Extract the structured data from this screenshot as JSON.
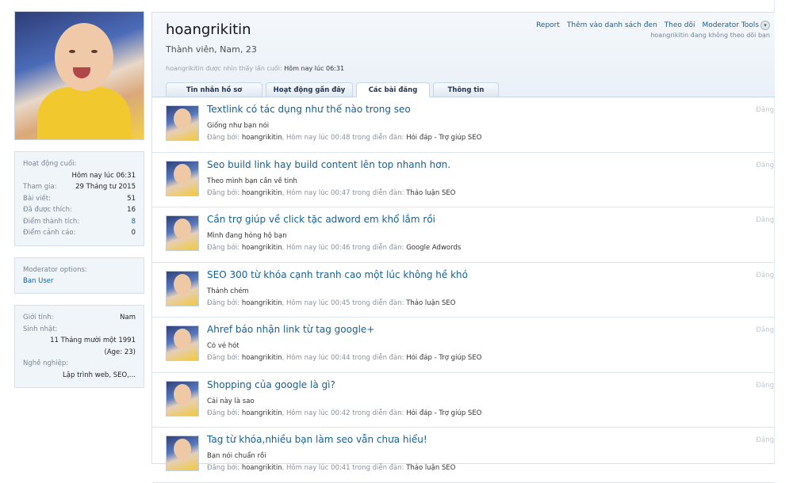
{
  "profile": {
    "username": "hoangrikitin",
    "user_title": "Thành viên, Nam, 23",
    "last_seen_label": "hoangrikitin được nhìn thấy lần cuối:",
    "last_seen_value": "Hôm nay lúc 06:31",
    "links": [
      "Report",
      "Thêm vào danh sách đen",
      "Theo dõi",
      "Moderator Tools"
    ],
    "not_following": "hoangrikitin đang không theo dõi bạn"
  },
  "tabs": [
    {
      "label": "Tin nhắn hồ sơ"
    },
    {
      "label": "Hoạt động gần đây"
    },
    {
      "label": "Các bài đăng",
      "active": true
    },
    {
      "label": "Thông tin"
    }
  ],
  "stats": {
    "last_activity_label": "Hoạt động cuối:",
    "last_activity_value": "Hôm nay lúc 06:31",
    "rows": [
      {
        "label": "Tham gia:",
        "value": "29 Tháng tư 2015"
      },
      {
        "label": "Bài viết:",
        "value": "51"
      },
      {
        "label": "Đã được thích:",
        "value": "16"
      },
      {
        "label": "Điểm thành tích:",
        "value": "8"
      },
      {
        "label": "Điểm cảnh cáo:",
        "value": "0"
      }
    ]
  },
  "moderator": {
    "label": "Moderator options:",
    "ban_user": "Ban User"
  },
  "info": {
    "gender_label": "Giới tính:",
    "gender_value": "Nam",
    "birthday_label": "Sinh nhật:",
    "birthday_value": "11 Tháng mười một 1991",
    "age_value": "(Age: 23)",
    "job_label": "Nghề nghiệp:",
    "job_value": "Lập trình web, SEO,..."
  },
  "posts": [
    {
      "title": "Textlink có tác dụng như thế nào trong seo",
      "snippet": "Giống như bạn nói",
      "meta_prefix": "Đăng bởi: ",
      "author": "hoangrikitin",
      "meta_mid": ", Hôm nay lúc 00:48 trong diễn đàn: ",
      "forum": "Hỏi đáp - Trợ giúp SEO",
      "type": "Đăng"
    },
    {
      "title": "Seo build link hay build content lên top nhanh hơn.",
      "snippet": "Theo mình bạn cần về tinh",
      "meta_prefix": "Đăng bởi: ",
      "author": "hoangrikitin",
      "meta_mid": ", Hôm nay lúc 00:47 trong diễn đàn: ",
      "forum": "Thảo luận SEO",
      "type": "Đăng"
    },
    {
      "title": "Cần trợ giúp về click tặc adword em khổ lắm rồi",
      "snippet": "Mình đang hỏng hộ bạn",
      "meta_prefix": "Đăng bởi: ",
      "author": "hoangrikitin",
      "meta_mid": ", Hôm nay lúc 00:46 trong diễn đàn: ",
      "forum": "Google Adwords",
      "type": "Đăng"
    },
    {
      "title": "SEO 300 từ khóa cạnh tranh cao một lúc không hề khó",
      "snippet": "Thánh chém",
      "meta_prefix": "Đăng bởi: ",
      "author": "hoangrikitin",
      "meta_mid": ", Hôm nay lúc 00:45 trong diễn đàn: ",
      "forum": "Thảo luận SEO",
      "type": "Đăng"
    },
    {
      "title": "Ahref báo nhận link từ tag google+",
      "snippet": "Có vẻ hót",
      "meta_prefix": "Đăng bởi: ",
      "author": "hoangrikitin",
      "meta_mid": ", Hôm nay lúc 00:44 trong diễn đàn: ",
      "forum": "Hỏi đáp - Trợ giúp SEO",
      "type": "Đăng"
    },
    {
      "title": "Shopping của google là gì?",
      "snippet": "Cái này là sao",
      "meta_prefix": "Đăng bởi: ",
      "author": "hoangrikitin",
      "meta_mid": ", Hôm nay lúc 00:42 trong diễn đàn: ",
      "forum": "Hỏi đáp - Trợ giúp SEO",
      "type": "Đăng"
    },
    {
      "title": "Tag từ khóa,nhiều bạn làm seo vẫn chưa hiểu!",
      "snippet": "Bạn nói chuẩn rồi",
      "meta_prefix": "Đăng bởi: ",
      "author": "hoangrikitin",
      "meta_mid": ", Hôm nay lúc 00:41 trong diễn đàn: ",
      "forum": "Thảo luận SEO",
      "type": "Đăng"
    }
  ]
}
